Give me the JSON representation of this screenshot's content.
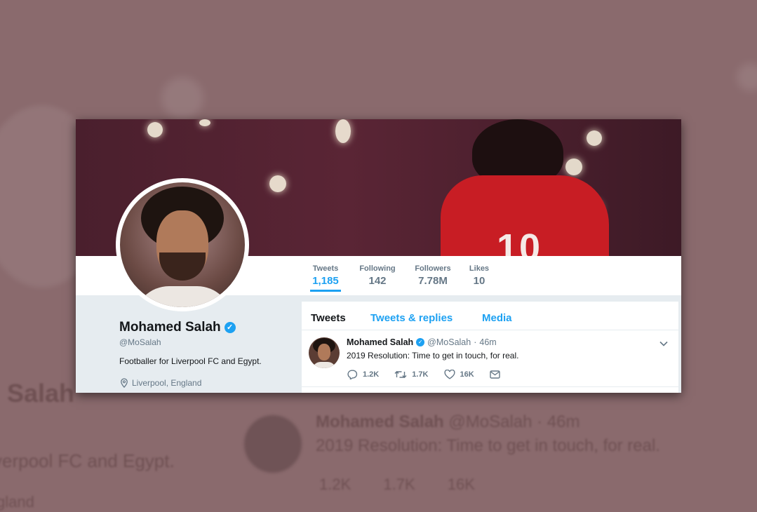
{
  "backdrop": {
    "name": "Salah",
    "bio": "verpool FC and Egypt.",
    "location": "gland",
    "tweet_name": "Mohamed Salah",
    "tweet_meta": "@MoSalah · 46m",
    "tweet_text": "2019 Resolution: Time to get in touch, for real.",
    "tweet_actions": "1.2K 1.7K 16K"
  },
  "banner": {
    "jersey_number": "10"
  },
  "stats": [
    {
      "label": "Tweets",
      "value": "1,185"
    },
    {
      "label": "Following",
      "value": "142"
    },
    {
      "label": "Followers",
      "value": "7.78M"
    },
    {
      "label": "Likes",
      "value": "10"
    }
  ],
  "profile": {
    "name": "Mohamed Salah",
    "handle": "@MoSalah",
    "bio": "Footballer for Liverpool FC and Egypt.",
    "location": "Liverpool, England"
  },
  "tabs": [
    {
      "label": "Tweets"
    },
    {
      "label": "Tweets & replies"
    },
    {
      "label": "Media"
    }
  ],
  "tweet": {
    "name": "Mohamed Salah",
    "handle": "@MoSalah",
    "separator": "·",
    "time": "46m",
    "text": "2019 Resolution: Time to get in touch, for real.",
    "replies": "1.2K",
    "retweets": "1.7K",
    "likes": "16K"
  },
  "colors": {
    "accent": "#1da1f2",
    "text_primary": "#14171a",
    "text_secondary": "#657786",
    "jersey": "#c81d24",
    "backdrop": "#8a6a6d"
  },
  "icons": [
    "verified-badge-icon",
    "location-pin-icon",
    "chevron-down-icon",
    "reply-icon",
    "retweet-icon",
    "heart-icon",
    "direct-message-icon"
  ]
}
